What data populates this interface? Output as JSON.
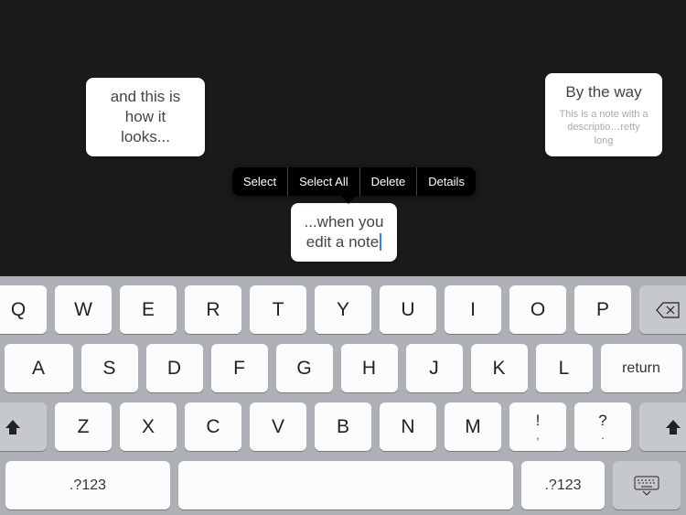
{
  "drag_handle": {
    "name": "drag-handle"
  },
  "notes": {
    "note1": {
      "title": "and this is how it looks..."
    },
    "note2": {
      "title": "By the way",
      "desc": "This is a note with a descriptio…retty long"
    },
    "note3": {
      "title": "...when you edit a note"
    }
  },
  "context_menu": {
    "select": "Select",
    "select_all": "Select All",
    "delete": "Delete",
    "details": "Details"
  },
  "keyboard": {
    "row1": [
      "Q",
      "W",
      "E",
      "R",
      "T",
      "Y",
      "U",
      "I",
      "O",
      "P"
    ],
    "row2": [
      "A",
      "S",
      "D",
      "F",
      "G",
      "H",
      "J",
      "K",
      "L"
    ],
    "row3": [
      "Z",
      "X",
      "C",
      "V",
      "B",
      "N",
      "M"
    ],
    "punct1": "!",
    "punct1_sub": ",",
    "punct2": "?",
    "punct2_sub": ".",
    "return": "return",
    "mode": ".?123"
  }
}
